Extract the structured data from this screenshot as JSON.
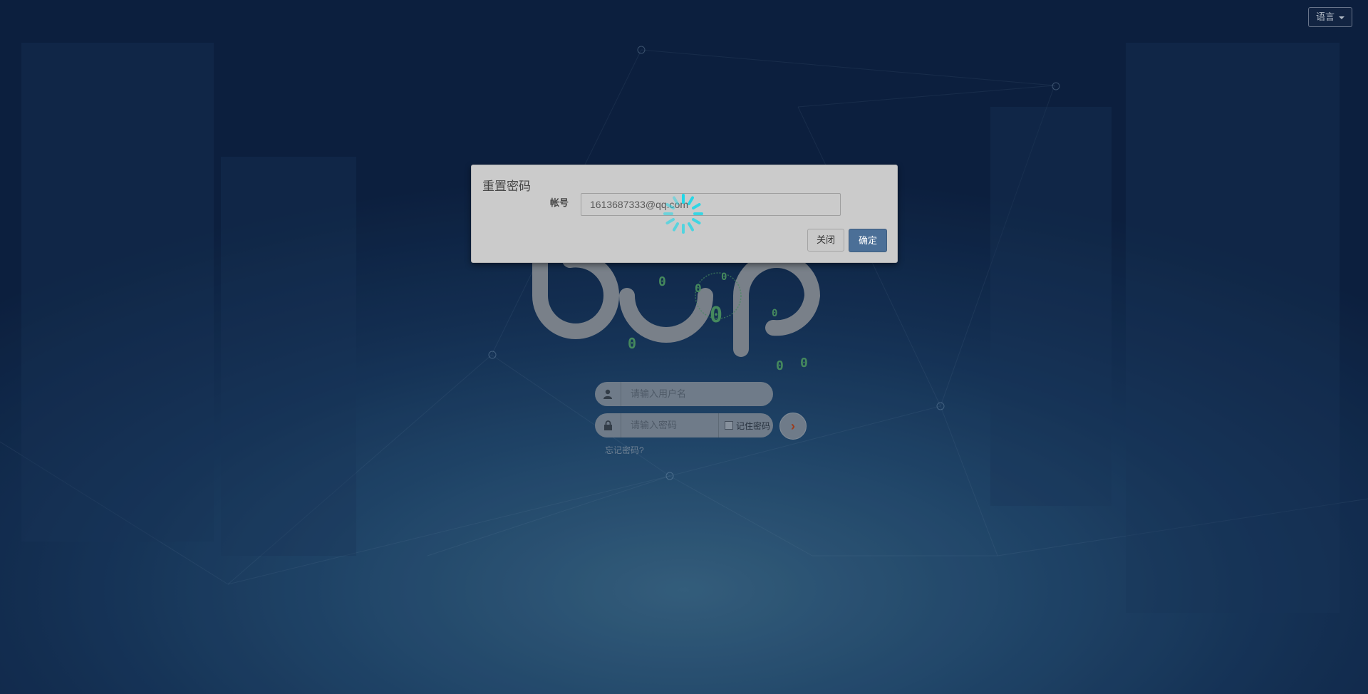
{
  "header": {
    "language_label": "语言"
  },
  "logo": {
    "bits": [
      "0",
      "0",
      "0",
      "0",
      "0",
      "0",
      "0",
      "0"
    ]
  },
  "login": {
    "username_placeholder": "请输入用户名",
    "password_placeholder": "请输入密码",
    "remember_label": "记住密码",
    "forgot_label": "忘记密码?"
  },
  "modal": {
    "title": "重置密码",
    "account_label": "帐号",
    "account_value": "1613687333@qq.com",
    "close_label": "关闭",
    "confirm_label": "确定"
  },
  "colors": {
    "accent": "#4b6f97",
    "spinner": "#1fd8e8",
    "arrow": "#b3441f"
  },
  "icons": [
    "user-icon",
    "lock-icon",
    "arrow-right-icon",
    "loading-spinner-icon",
    "caret-down-icon"
  ]
}
